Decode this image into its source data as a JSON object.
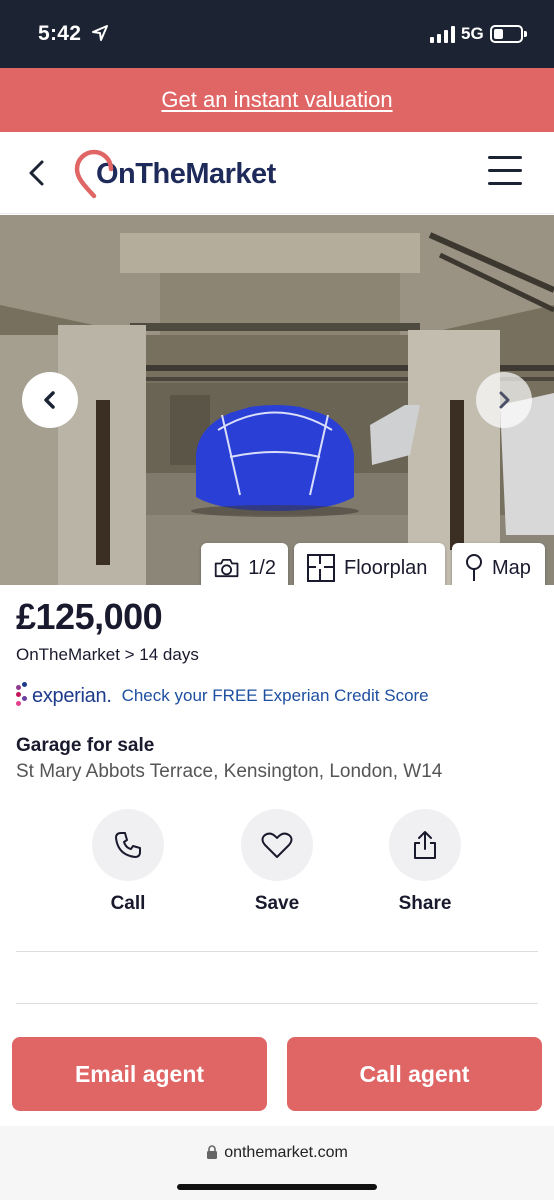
{
  "status_bar": {
    "time": "5:42",
    "network": "5G"
  },
  "promo": {
    "label": "Get an instant valuation"
  },
  "header": {
    "logo_text": "OnTheMarket"
  },
  "gallery": {
    "counter": "1/2",
    "floorplan_label": "Floorplan",
    "map_label": "Map"
  },
  "listing": {
    "price": "£125,000",
    "source": "OnTheMarket > 14 days",
    "experian_brand": "experian.",
    "experian_cta": "Check your FREE Experian Credit Score",
    "property_type": "Garage for sale",
    "address": "St Mary Abbots Terrace, Kensington, London, W14"
  },
  "actions": {
    "call": "Call",
    "save": "Save",
    "share": "Share"
  },
  "cta": {
    "email_agent": "Email agent",
    "call_agent": "Call agent"
  },
  "browser": {
    "url": "onthemarket.com"
  },
  "colors": {
    "brand": "#e06666",
    "navy": "#1e2a5a",
    "status_bar": "#1c2333"
  }
}
